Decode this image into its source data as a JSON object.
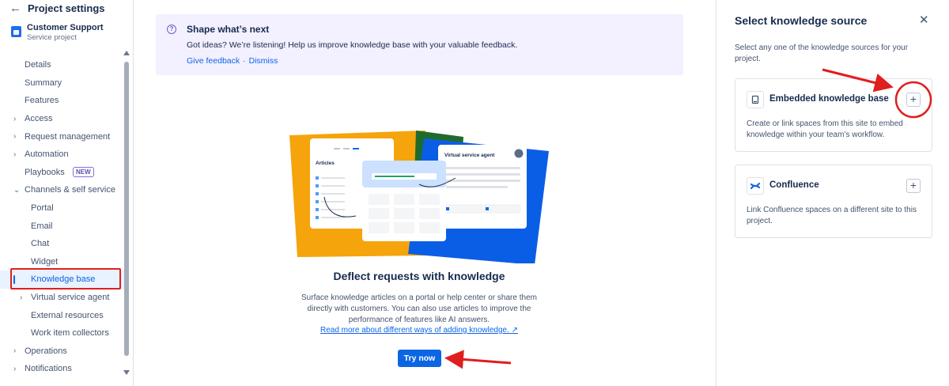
{
  "sidebar": {
    "title": "Project settings",
    "project": {
      "name": "Customer Support",
      "type": "Service project"
    },
    "items": [
      {
        "label": "Details",
        "level": 0,
        "chevron": false
      },
      {
        "label": "Summary",
        "level": 0,
        "chevron": false
      },
      {
        "label": "Features",
        "level": 0,
        "chevron": false
      },
      {
        "label": "Access",
        "level": 0,
        "chevron": true
      },
      {
        "label": "Request management",
        "level": 0,
        "chevron": true
      },
      {
        "label": "Automation",
        "level": 0,
        "chevron": true
      },
      {
        "label": "Playbooks",
        "level": 0,
        "chevron": false,
        "badge": "NEW"
      },
      {
        "label": "Channels & self service",
        "level": 0,
        "chevron": true,
        "expanded": true
      },
      {
        "label": "Portal",
        "level": 1,
        "chevron": false
      },
      {
        "label": "Email",
        "level": 1,
        "chevron": false
      },
      {
        "label": "Chat",
        "level": 1,
        "chevron": false
      },
      {
        "label": "Widget",
        "level": 1,
        "chevron": false
      },
      {
        "label": "Knowledge base",
        "level": 1,
        "chevron": false,
        "active": true
      },
      {
        "label": "Virtual service agent",
        "level": 1,
        "chevron": true
      },
      {
        "label": "External resources",
        "level": 1,
        "chevron": false
      },
      {
        "label": "Work item collectors",
        "level": 1,
        "chevron": false
      },
      {
        "label": "Operations",
        "level": 0,
        "chevron": true
      },
      {
        "label": "Notifications",
        "level": 0,
        "chevron": true
      }
    ]
  },
  "banner": {
    "title": "Shape what’s next",
    "text": "Got ideas? We’re listening! Help us improve knowledge base with your valuable feedback.",
    "link_feedback": "Give feedback",
    "separator": "·",
    "link_dismiss": "Dismiss"
  },
  "illustration": {
    "articles_label": "Articles",
    "agent_label": "Virtual service agent"
  },
  "main": {
    "heading": "Deflect requests with knowledge",
    "description": "Surface knowledge articles on a portal or help center or share them directly with customers. You can also use articles to improve the performance of features like AI answers.",
    "read_more": "Read more about different ways of adding knowledge.",
    "try_button": "Try now"
  },
  "panel": {
    "title": "Select knowledge source",
    "description": "Select any one of the knowledge sources for your project.",
    "cards": [
      {
        "title": "Embedded knowledge base",
        "description": "Create or link spaces from this site to embed knowledge within your team’s workflow.",
        "icon": "book-icon"
      },
      {
        "title": "Confluence",
        "description": "Link Confluence spaces on a different site to this project.",
        "icon": "confluence-icon"
      }
    ]
  },
  "colors": {
    "primary": "#0c66e4",
    "banner_bg": "#f3f0ff",
    "annotation_red": "#e01e1e",
    "illus_orange": "#f5a40b",
    "illus_blue": "#0a5ee6",
    "illus_green": "#1f6b2e"
  }
}
